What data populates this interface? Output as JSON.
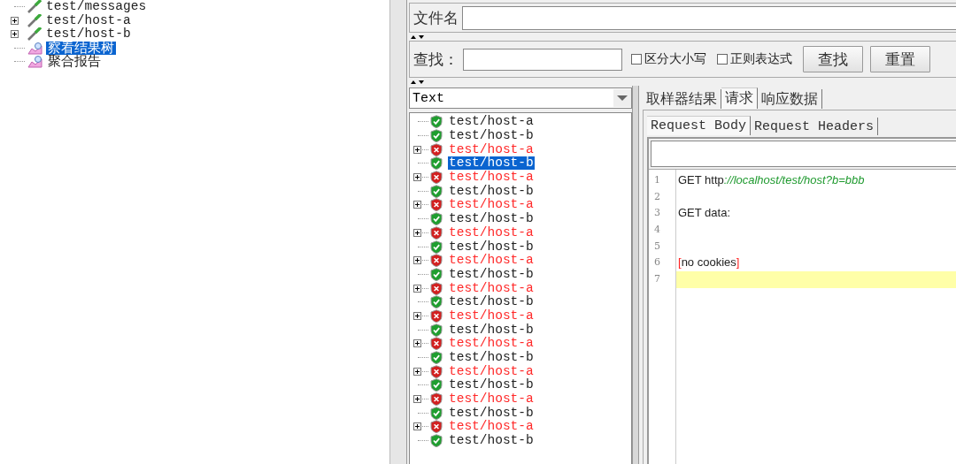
{
  "test_plan_tree": {
    "items": [
      {
        "kind": "sampler",
        "label": "test/messages",
        "expandable": false,
        "selected": false
      },
      {
        "kind": "sampler",
        "label": "test/host-a",
        "expandable": true,
        "selected": false
      },
      {
        "kind": "sampler",
        "label": "test/host-b",
        "expandable": true,
        "selected": false
      },
      {
        "kind": "listener",
        "label": "察看结果树",
        "expandable": false,
        "selected": true
      },
      {
        "kind": "listener",
        "label": "聚合报告",
        "expandable": false,
        "selected": false
      }
    ]
  },
  "file_bar": {
    "label": "文件名"
  },
  "search_bar": {
    "label": "查找：",
    "options": [
      {
        "label": "区分大小写",
        "checked": false
      },
      {
        "label": "正则表达式",
        "checked": false
      }
    ],
    "buttons": [
      "查找",
      "重置"
    ]
  },
  "renderer": {
    "value": "Text"
  },
  "results": [
    {
      "label": "test/host-a",
      "kind": "success",
      "expandable": false,
      "selected": false
    },
    {
      "label": "test/host-b",
      "kind": "success",
      "expandable": false,
      "selected": false
    },
    {
      "label": "test/host-a",
      "kind": "error",
      "expandable": true,
      "selected": false
    },
    {
      "label": "test/host-b",
      "kind": "success",
      "expandable": false,
      "selected": true
    },
    {
      "label": "test/host-a",
      "kind": "error",
      "expandable": true,
      "selected": false
    },
    {
      "label": "test/host-b",
      "kind": "success",
      "expandable": false,
      "selected": false
    },
    {
      "label": "test/host-a",
      "kind": "error",
      "expandable": true,
      "selected": false
    },
    {
      "label": "test/host-b",
      "kind": "success",
      "expandable": false,
      "selected": false
    },
    {
      "label": "test/host-a",
      "kind": "error",
      "expandable": true,
      "selected": false
    },
    {
      "label": "test/host-b",
      "kind": "success",
      "expandable": false,
      "selected": false
    },
    {
      "label": "test/host-a",
      "kind": "error",
      "expandable": true,
      "selected": false
    },
    {
      "label": "test/host-b",
      "kind": "success",
      "expandable": false,
      "selected": false
    },
    {
      "label": "test/host-a",
      "kind": "error",
      "expandable": true,
      "selected": false
    },
    {
      "label": "test/host-b",
      "kind": "success",
      "expandable": false,
      "selected": false
    },
    {
      "label": "test/host-a",
      "kind": "error",
      "expandable": true,
      "selected": false
    },
    {
      "label": "test/host-b",
      "kind": "success",
      "expandable": false,
      "selected": false
    },
    {
      "label": "test/host-a",
      "kind": "error",
      "expandable": true,
      "selected": false
    },
    {
      "label": "test/host-b",
      "kind": "success",
      "expandable": false,
      "selected": false
    },
    {
      "label": "test/host-a",
      "kind": "error",
      "expandable": true,
      "selected": false
    },
    {
      "label": "test/host-b",
      "kind": "success",
      "expandable": false,
      "selected": false
    },
    {
      "label": "test/host-a",
      "kind": "error",
      "expandable": true,
      "selected": false
    },
    {
      "label": "test/host-b",
      "kind": "success",
      "expandable": false,
      "selected": false
    },
    {
      "label": "test/host-a",
      "kind": "error",
      "expandable": true,
      "selected": false
    },
    {
      "label": "test/host-b",
      "kind": "success",
      "expandable": false,
      "selected": false
    }
  ],
  "result_tabs": [
    {
      "label": "取样器结果",
      "selected": false
    },
    {
      "label": "请求",
      "selected": true
    },
    {
      "label": "响应数据",
      "selected": false
    }
  ],
  "request_tabs": [
    {
      "label": "Request Body",
      "selected": true
    },
    {
      "label": "Request Headers",
      "selected": false
    }
  ],
  "editor": {
    "lines": [
      {
        "number": "1",
        "current": false,
        "segments": [
          {
            "kind": "plain",
            "text": "GET http"
          },
          {
            "kind": "url",
            "text": "://localhost/test/host?b=bbb"
          }
        ]
      },
      {
        "number": "2",
        "current": false
      },
      {
        "number": "3",
        "current": false,
        "segments": [
          {
            "kind": "plain",
            "text": "GET data:"
          }
        ]
      },
      {
        "number": "4",
        "current": false
      },
      {
        "number": "5",
        "current": false
      },
      {
        "number": "6",
        "current": false,
        "segments": [
          {
            "kind": "bracket",
            "text": "["
          },
          {
            "kind": "plain",
            "text": "no cookies"
          },
          {
            "kind": "bracket",
            "text": "]"
          }
        ]
      },
      {
        "number": "7",
        "current": true
      }
    ]
  }
}
